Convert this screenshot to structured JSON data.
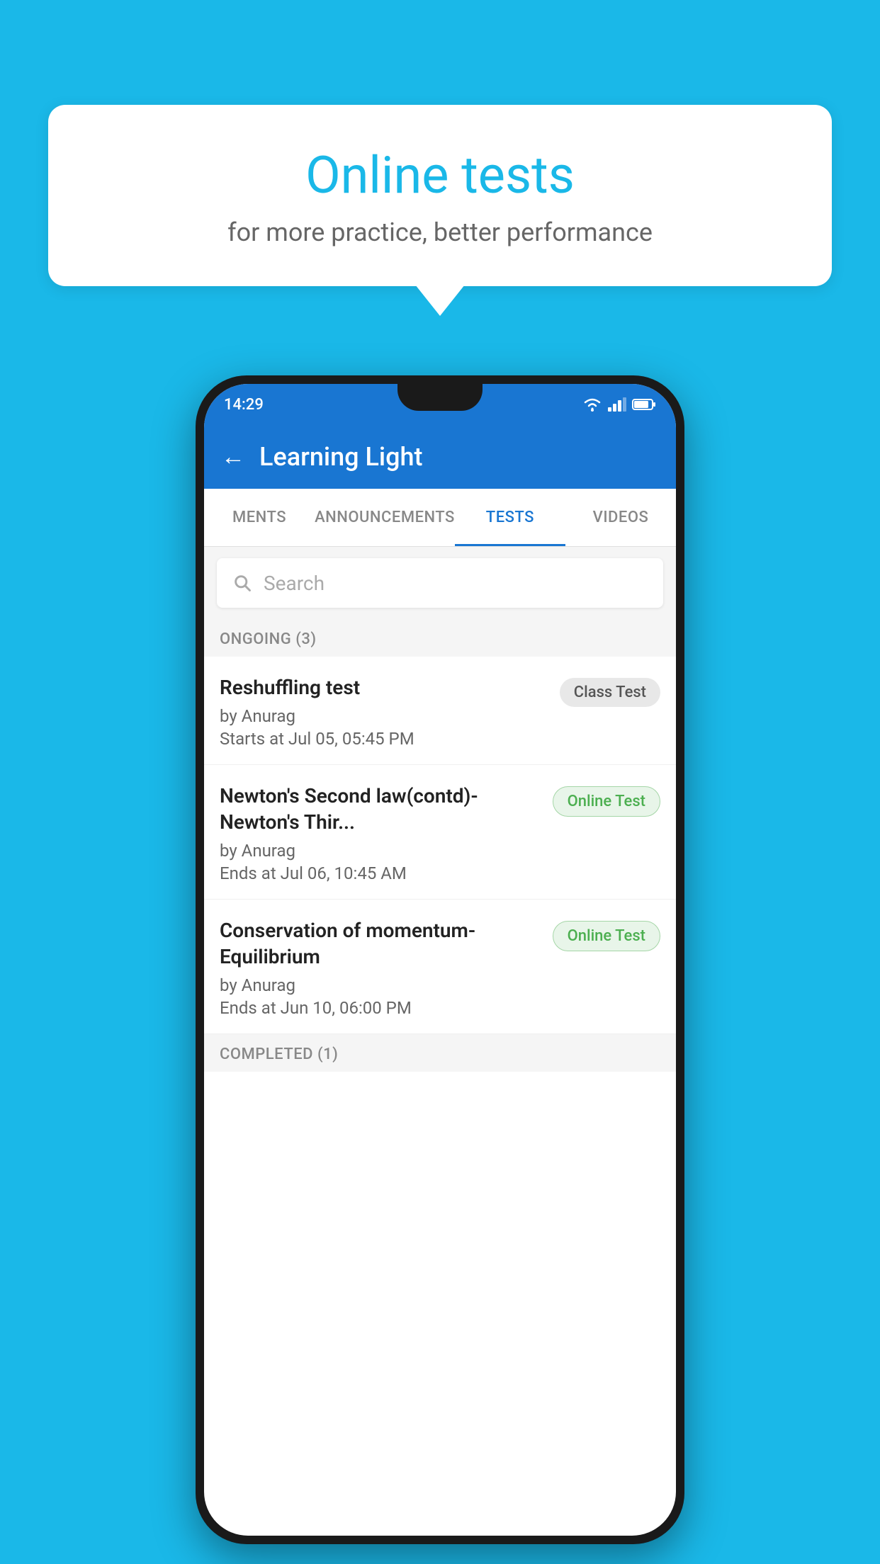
{
  "background_color": "#1ab8e8",
  "speech_bubble": {
    "title": "Online tests",
    "subtitle": "for more practice, better performance"
  },
  "phone": {
    "status_bar": {
      "time": "14:29",
      "wifi_icon": "wifi-icon",
      "signal_icon": "signal-icon",
      "battery_icon": "battery-icon"
    },
    "app_bar": {
      "back_label": "←",
      "title": "Learning Light"
    },
    "tabs": [
      {
        "label": "MENTS",
        "active": false
      },
      {
        "label": "ANNOUNCEMENTS",
        "active": false
      },
      {
        "label": "TESTS",
        "active": true
      },
      {
        "label": "VIDEOS",
        "active": false
      }
    ],
    "search": {
      "placeholder": "Search"
    },
    "ongoing_section": {
      "label": "ONGOING (3)",
      "tests": [
        {
          "name": "Reshuffling test",
          "author": "by Anurag",
          "time": "Starts at  Jul 05, 05:45 PM",
          "badge": "Class Test",
          "badge_type": "class"
        },
        {
          "name": "Newton's Second law(contd)-Newton's Thir...",
          "author": "by Anurag",
          "time": "Ends at  Jul 06, 10:45 AM",
          "badge": "Online Test",
          "badge_type": "online"
        },
        {
          "name": "Conservation of momentum-Equilibrium",
          "author": "by Anurag",
          "time": "Ends at  Jun 10, 06:00 PM",
          "badge": "Online Test",
          "badge_type": "online"
        }
      ]
    },
    "completed_section": {
      "label": "COMPLETED (1)"
    }
  }
}
